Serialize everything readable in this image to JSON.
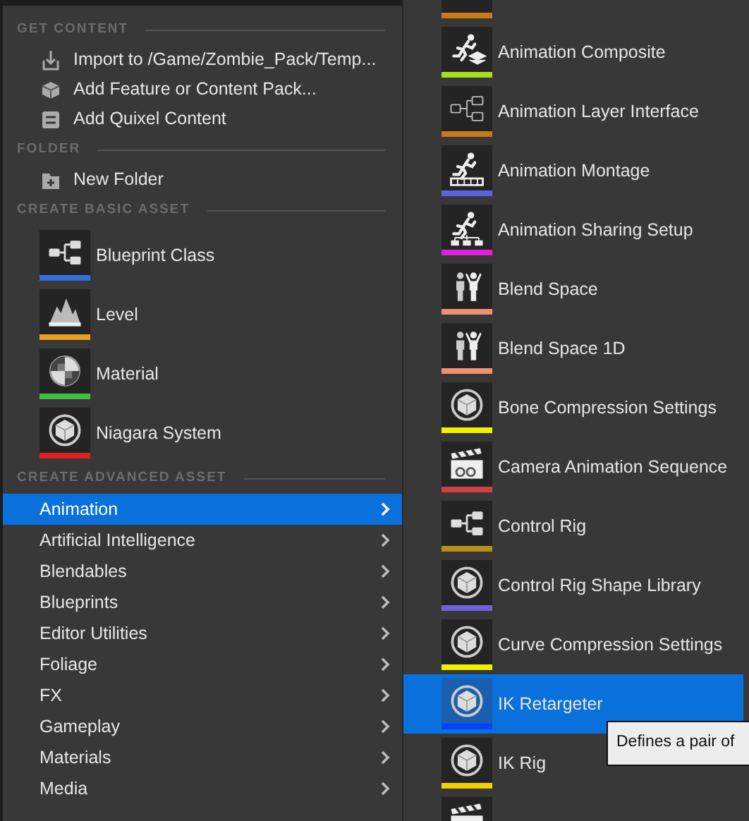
{
  "left_menu": {
    "sections": [
      {
        "title": "GET CONTENT",
        "kind": "actions",
        "items": [
          {
            "kind": "import",
            "label": "Import to /Game/Zombie_Pack/Temp..."
          },
          {
            "kind": "feature",
            "label": "Add Feature or Content Pack..."
          },
          {
            "kind": "quixel",
            "label": "Add Quixel Content"
          }
        ]
      },
      {
        "title": "FOLDER",
        "kind": "actions",
        "items": [
          {
            "kind": "folder",
            "label": "New Folder"
          }
        ]
      },
      {
        "title": "CREATE BASIC ASSET",
        "kind": "assets",
        "items": [
          {
            "kind": "blueprint",
            "label": "Blueprint Class",
            "color": "#3a6ee0"
          },
          {
            "kind": "level",
            "label": "Level",
            "color": "#e8a020"
          },
          {
            "kind": "material",
            "label": "Material",
            "color": "#40c040"
          },
          {
            "kind": "cube",
            "label": "Niagara System",
            "color": "#e02020"
          }
        ]
      },
      {
        "title": "CREATE ADVANCED ASSET",
        "kind": "categories",
        "items": [
          {
            "label": "Animation",
            "selected": true
          },
          {
            "label": "Artificial Intelligence",
            "selected": false
          },
          {
            "label": "Blendables",
            "selected": false
          },
          {
            "label": "Blueprints",
            "selected": false
          },
          {
            "label": "Editor Utilities",
            "selected": false
          },
          {
            "label": "Foliage",
            "selected": false
          },
          {
            "label": "FX",
            "selected": false
          },
          {
            "label": "Gameplay",
            "selected": false
          },
          {
            "label": "Materials",
            "selected": false
          },
          {
            "label": "Media",
            "selected": false
          }
        ]
      }
    ]
  },
  "submenu": {
    "items": [
      {
        "color": "#c87a14"
      },
      {
        "kind": "runner-layers",
        "label": "Animation Composite",
        "color": "#a8e020",
        "selected": false
      },
      {
        "kind": "outline-blueprint",
        "label": "Animation Layer Interface",
        "color": "#c87a14",
        "selected": false
      },
      {
        "kind": "runner-track",
        "label": "Animation Montage",
        "color": "#6060e0",
        "selected": false
      },
      {
        "kind": "runner-tree",
        "label": "Animation Sharing Setup",
        "color": "#e020e0",
        "selected": false
      },
      {
        "kind": "figures",
        "label": "Blend Space",
        "color": "#f09070",
        "selected": false
      },
      {
        "kind": "figures",
        "label": "Blend Space 1D",
        "color": "#f09070",
        "selected": false
      },
      {
        "kind": "cube",
        "label": "Bone Compression Settings",
        "color": "#f0f000",
        "selected": false
      },
      {
        "kind": "clapper",
        "label": "Camera Animation Sequence",
        "color": "#d04040",
        "selected": false
      },
      {
        "kind": "blueprint",
        "label": "Control Rig",
        "color": "#b8901a",
        "selected": false
      },
      {
        "kind": "cube",
        "label": "Control Rig Shape Library",
        "color": "#7060e0",
        "selected": false
      },
      {
        "kind": "cube",
        "label": "Curve Compression Settings",
        "color": "#f0f000",
        "selected": false
      },
      {
        "kind": "cube",
        "label": "IK Retargeter",
        "color": "#0040ff",
        "selected": true
      },
      {
        "kind": "cube",
        "label": "IK Rig",
        "color": "#f0d000",
        "selected": false
      },
      {
        "kind": "clapper"
      }
    ]
  },
  "tooltip": {
    "text": "Defines a pair of"
  }
}
